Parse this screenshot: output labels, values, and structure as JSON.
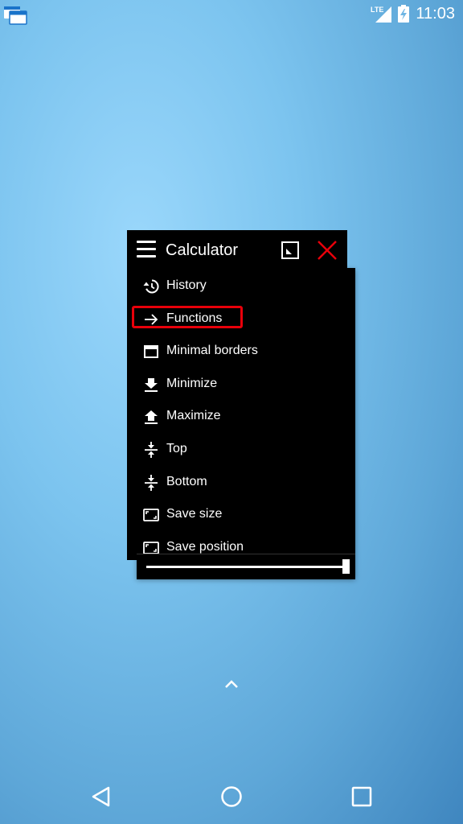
{
  "status_bar": {
    "network_label": "LTE",
    "time": "11:03"
  },
  "window": {
    "title": "Calculator"
  },
  "menu": {
    "items": [
      {
        "label": "History",
        "icon": "history-icon"
      },
      {
        "label": "Functions",
        "icon": "arrow-right-icon"
      },
      {
        "label": "Minimal borders",
        "icon": "window-icon"
      },
      {
        "label": "Minimize",
        "icon": "download-icon"
      },
      {
        "label": "Maximize",
        "icon": "upload-icon"
      },
      {
        "label": "Top",
        "icon": "vertical-align-icon"
      },
      {
        "label": "Bottom",
        "icon": "vertical-align-icon"
      },
      {
        "label": "Save size",
        "icon": "aspect-ratio-icon"
      },
      {
        "label": "Save position",
        "icon": "aspect-ratio-icon"
      }
    ],
    "highlighted_index": 1
  },
  "opacity_slider": {
    "value_fraction": 1.0
  },
  "colors": {
    "highlight": "#e8000a",
    "close": "#e8000a",
    "window_bg": "#000000"
  }
}
